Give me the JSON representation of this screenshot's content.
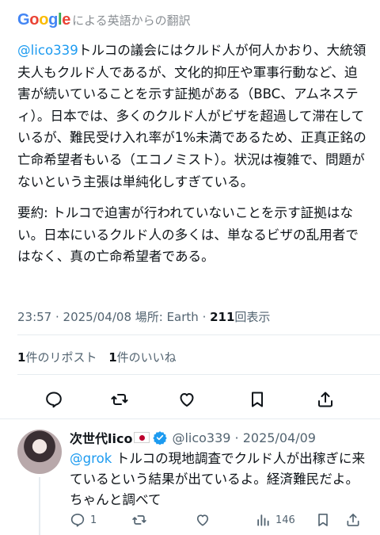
{
  "translation": {
    "logo": [
      "G",
      "o",
      "o",
      "g",
      "l",
      "e"
    ],
    "suffix": "による英語からの翻訳"
  },
  "tweet": {
    "mention": "@lico339",
    "paragraph1_after_mention": "トルコの議会にはクルド人が何人かおり、大統領夫人もクルド人であるが、文化的抑圧や軍事行動など、迫害が続いていることを示す証拠がある（BBC、アムネスティ）。日本では、多くのクルド人がビザを超過して滞在しているが、難民受け入れ率が1%未満であるため、正真正銘の亡命希望者もいる（エコノミスト）。状況は複雑で、問題がないという主張は単純化しすぎている。",
    "paragraph2": "要約: トルコで迫害が行われていないことを示す証拠はない。日本にいるクルド人の多くは、単なるビザの乱用者ではなく、真の亡命希望者である。",
    "meta_prefix": "23:57 · 2025/04/08 場所: Earth · ",
    "views_count": "211",
    "views_label": "回表示",
    "reposts_count": "1",
    "reposts_label": "件のリポスト",
    "likes_count": "1",
    "likes_label": "件のいいね"
  },
  "actions": {
    "reply_icon": "speech-bubble-icon",
    "retweet_icon": "retweet-arrows-icon",
    "like_icon": "heart-icon",
    "bookmark_icon": "bookmark-icon",
    "share_icon": "share-upload-icon"
  },
  "reply": {
    "name": "次世代lico",
    "handle_date": "@lico339 · 2025/04/09",
    "mention": "@grok",
    "text_after_mention": " トルコの現地調査でクルド人が出稼ぎに来ているという結果が出ているよ。経済難民だよ。ちゃんと調べて",
    "reply_count": "1",
    "views_count": "146"
  },
  "colors": {
    "accent": "#1d9bf0",
    "text": "#0f1419",
    "secondary": "#536471",
    "divider": "#e6ecf0"
  }
}
